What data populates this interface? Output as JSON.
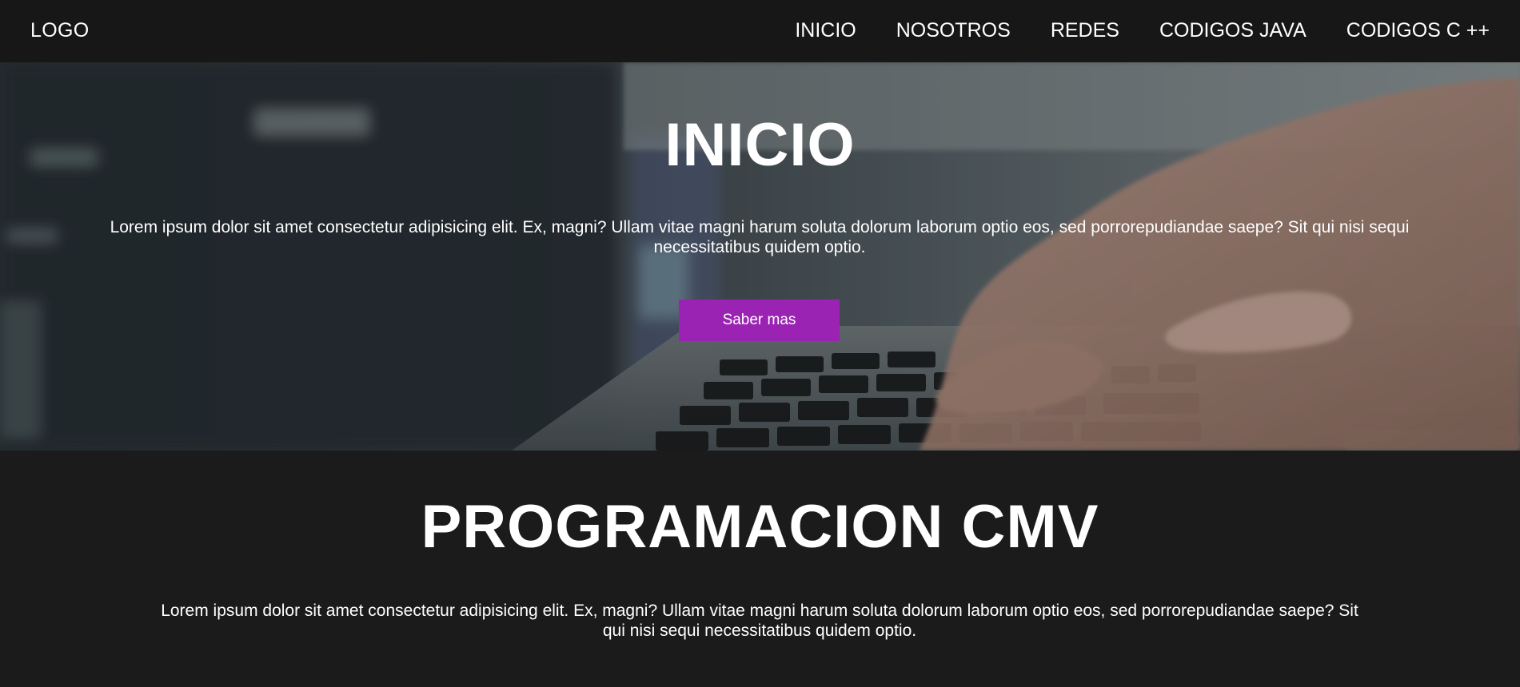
{
  "nav": {
    "logo": "LOGO",
    "links": [
      "INICIO",
      "NOSOTROS",
      "REDES",
      "CODIGOS JAVA",
      "CODIGOS C ++"
    ]
  },
  "hero": {
    "title": "INICIO",
    "text": "Lorem ipsum dolor sit amet consectetur adipisicing elit. Ex, magni? Ullam vitae magni harum soluta dolorum laborum optio eos, sed porrorepudiandae saepe? Sit qui nisi sequi necessitatibus quidem optio.",
    "button_label": "Saber mas"
  },
  "section": {
    "title": "PROGRAMACION CMV",
    "text": "Lorem ipsum dolor sit amet consectetur adipisicing elit. Ex, magni? Ullam vitae magni harum soluta dolorum laborum optio eos, sed porrorepudiandae saepe? Sit qui nisi sequi necessitatibus quidem optio."
  },
  "colors": {
    "navbar_bg": "#171717",
    "page_bg": "#1c1b1c",
    "button_accent": "#9b23b3",
    "text": "#ffffff"
  },
  "icons": [
    "hero-background-image"
  ]
}
